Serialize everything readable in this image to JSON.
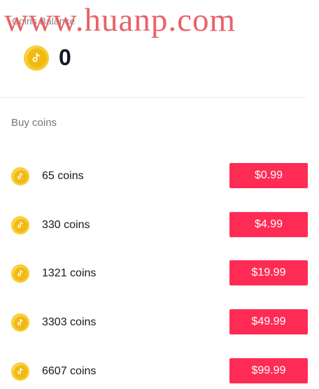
{
  "watermark": "www.huanp.com",
  "balance": {
    "label": "Coins Balance",
    "value": "0",
    "icon": "coin-icon"
  },
  "buy_section": {
    "label": "Buy coins"
  },
  "packages": [
    {
      "amount": "65 coins",
      "price": "$0.99",
      "icon": "coin-icon"
    },
    {
      "amount": "330 coins",
      "price": "$4.99",
      "icon": "coin-icon"
    },
    {
      "amount": "1321 coins",
      "price": "$19.99",
      "icon": "coin-icon"
    },
    {
      "amount": "3303 coins",
      "price": "$49.99",
      "icon": "coin-icon"
    },
    {
      "amount": "6607 coins",
      "price": "$99.99",
      "icon": "coin-icon"
    }
  ],
  "colors": {
    "accent": "#fe2c55",
    "coin": "#f8c726",
    "watermark": "#e8555b"
  }
}
